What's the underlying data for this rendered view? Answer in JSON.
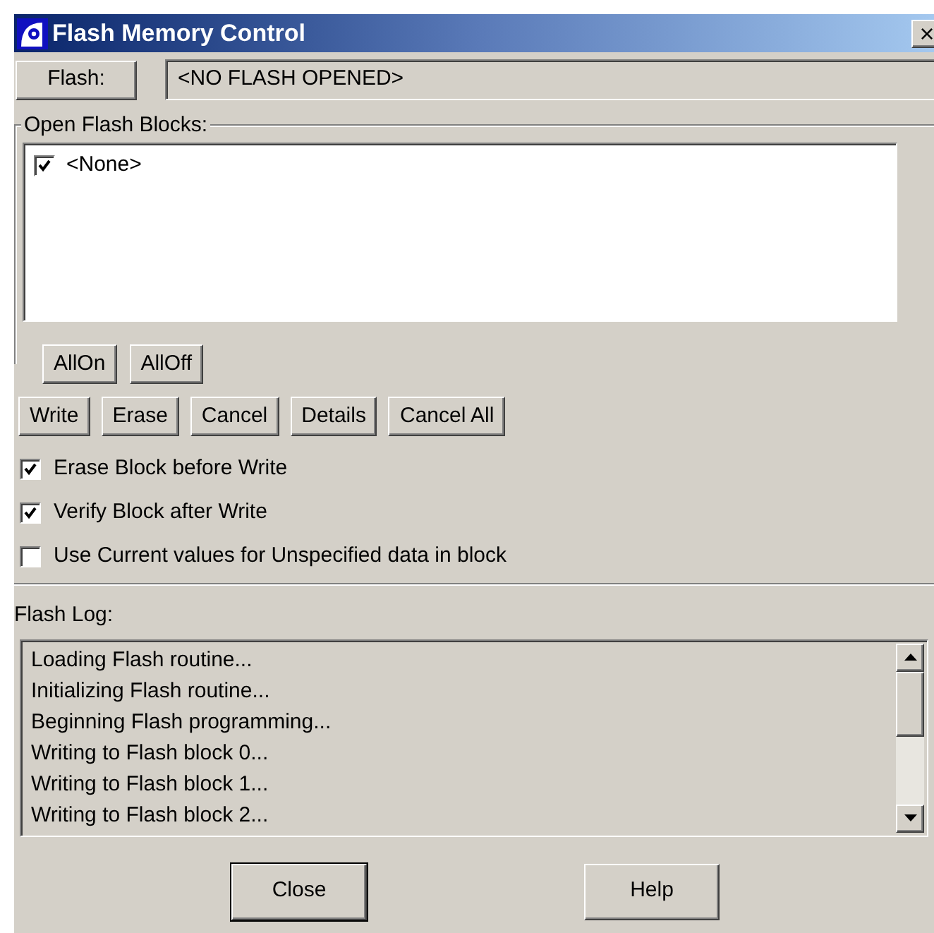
{
  "window": {
    "title": "Flash Memory Control",
    "close": "×"
  },
  "flash": {
    "button": "Flash:",
    "value": "<NO FLASH OPENED>"
  },
  "open_flash_blocks": {
    "label": "Open Flash Blocks:",
    "items": [
      {
        "label": "<None>",
        "checked": true
      }
    ]
  },
  "block_buttons": [
    "AllOn",
    "AllOff"
  ],
  "action_buttons": [
    "Write",
    "Erase",
    "Cancel",
    "Details",
    "Cancel All"
  ],
  "options": [
    {
      "label": "Erase Block before Write",
      "checked": true
    },
    {
      "label": "Verify Block after Write",
      "checked": true
    },
    {
      "label": "Use Current values for Unspecified data in block",
      "checked": false
    }
  ],
  "flash_log": {
    "label": "Flash Log:",
    "lines": [
      "Loading Flash routine...",
      "Initializing Flash routine...",
      "Beginning Flash programming...",
      "Writing to Flash block 0...",
      "Writing to Flash block 1...",
      "Writing to Flash block 2..."
    ]
  },
  "footer_buttons": [
    {
      "label": "Close",
      "default": true
    },
    {
      "label": "Help",
      "default": false
    }
  ]
}
